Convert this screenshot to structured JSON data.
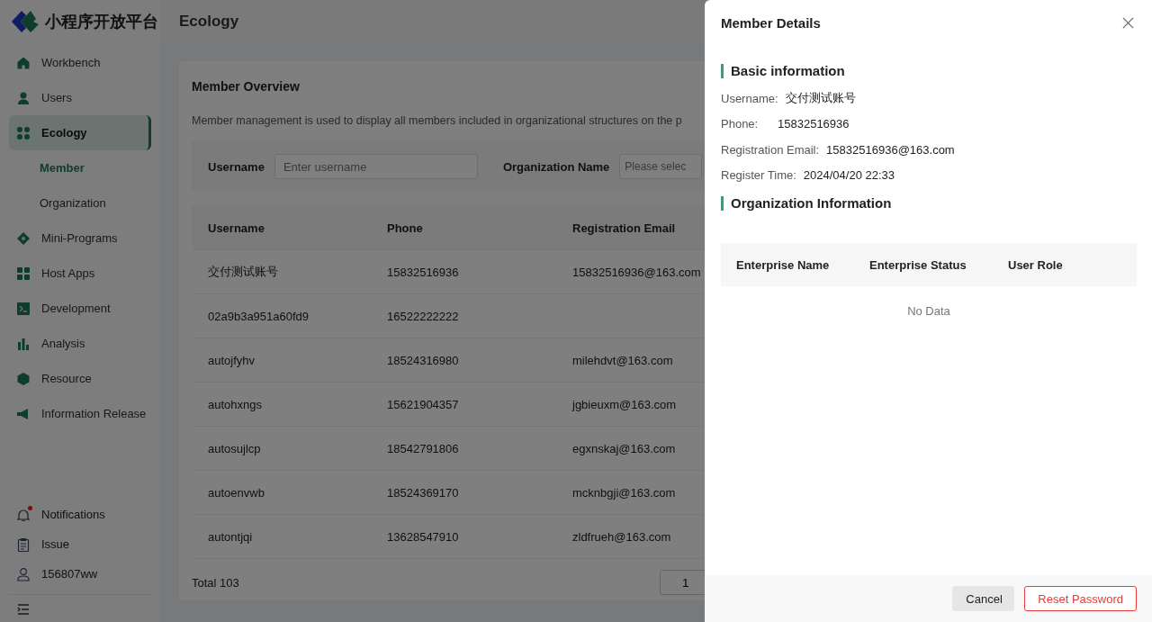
{
  "brand": {
    "title": "小程序开放平台"
  },
  "sidebar": {
    "items": [
      {
        "label": "Workbench",
        "selected": false
      },
      {
        "label": "Users",
        "selected": false
      },
      {
        "label": "Ecology",
        "selected": true,
        "children": [
          {
            "label": "Member",
            "selected": true
          },
          {
            "label": "Organization",
            "selected": false
          }
        ]
      },
      {
        "label": "Mini-Programs",
        "selected": false
      },
      {
        "label": "Host Apps",
        "selected": false
      },
      {
        "label": "Development",
        "selected": false
      },
      {
        "label": "Analysis",
        "selected": false
      },
      {
        "label": "Resource",
        "selected": false
      },
      {
        "label": "Information Release",
        "selected": false
      }
    ],
    "footer": [
      {
        "label": "Notifications",
        "badge": true
      },
      {
        "label": "Issue",
        "badge": false
      },
      {
        "label": "156807ww",
        "badge": false
      }
    ]
  },
  "header": {
    "title": "Ecology"
  },
  "card": {
    "title": "Member Overview",
    "description": "Member management is used to display all members included in organizational structures on the p",
    "filters": [
      {
        "label": "Username",
        "placeholder": "Enter username"
      },
      {
        "label": "Organization Name",
        "placeholder": "Please selec"
      }
    ],
    "table": {
      "columns": [
        "Username",
        "Phone",
        "Registration Email"
      ],
      "rows": [
        [
          "交付测试账号",
          "15832516936",
          "15832516936@163.com"
        ],
        [
          "02a9b3a951a60fd9",
          "16522222222",
          ""
        ],
        [
          "autojfyhv",
          "18524316980",
          "milehdvt@163.com"
        ],
        [
          "autohxngs",
          "15621904357",
          "jgbieuxm@163.com"
        ],
        [
          "autosujlcp",
          "18542791806",
          "egxnskaj@163.com"
        ],
        [
          "autoenvwb",
          "18524369170",
          "mcknbgji@163.com"
        ],
        [
          "autontjqi",
          "13628547910",
          "zldfrueh@163.com"
        ]
      ]
    },
    "total": "Total 103",
    "page": "1"
  },
  "drawer": {
    "title": "Member Details",
    "sections": [
      {
        "title": "Basic information",
        "kind": "fields",
        "fields": [
          {
            "label": "Username:",
            "value": "交付测试账号"
          },
          {
            "label": "Phone:",
            "value": "15832516936"
          },
          {
            "label": "Registration Email:",
            "value": "15832516936@163.com"
          },
          {
            "label": "Register Time:",
            "value": "2024/04/20 22:33"
          }
        ]
      },
      {
        "title": "Organization Information",
        "kind": "table",
        "columns": [
          "Enterprise Name",
          "Enterprise Status",
          "User Role"
        ],
        "empty": "No Data"
      }
    ],
    "buttons": [
      {
        "label": "Cancel",
        "kind": "default"
      },
      {
        "label": "Reset Password",
        "kind": "danger"
      }
    ]
  }
}
